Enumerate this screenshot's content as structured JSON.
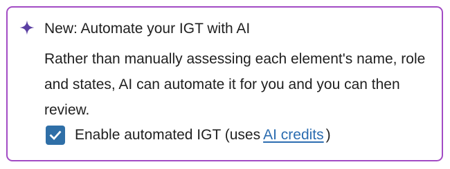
{
  "notice": {
    "icon": "sparkle-icon",
    "title": "New: Automate your IGT with AI",
    "body": "Rather than manually assessing each element's name, role and states, AI can automate it for you and you can then review.",
    "border_color": "#a24bc4"
  },
  "option": {
    "checked": true,
    "label_prefix": "Enable automated IGT (uses",
    "link_text": "AI credits",
    "label_suffix": ")",
    "checkbox_color": "#2f6fa7",
    "link_color": "#2b6cb0"
  },
  "colors": {
    "accent": "#5b3fa3"
  }
}
